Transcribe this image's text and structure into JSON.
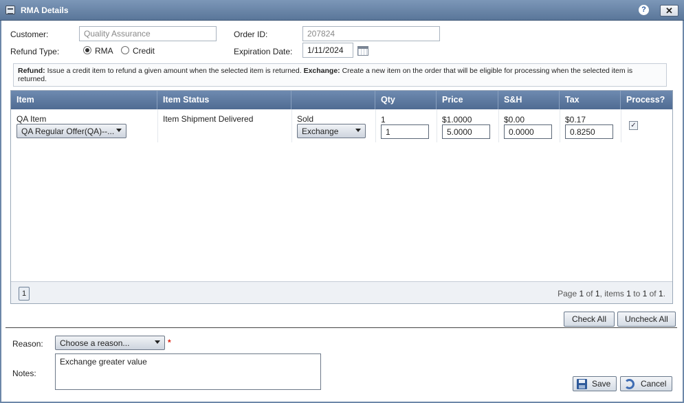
{
  "window": {
    "title": "RMA Details",
    "help_label": "?",
    "close_label": "✕"
  },
  "form": {
    "customer_label": "Customer:",
    "customer_value": "Quality Assurance",
    "order_id_label": "Order ID:",
    "order_id_value": "207824",
    "refund_type_label": "Refund Type:",
    "refund_options": [
      "RMA",
      "Credit"
    ],
    "refund_selected": "RMA",
    "expiration_label": "Expiration Date:",
    "expiration_value": "1/11/2024"
  },
  "note": {
    "refund_title": "Refund:",
    "refund_text": "Issue a credit item to refund a given amount when the selected item is returned.",
    "exchange_title": "Exchange:",
    "exchange_text": "Create a new item on the order that will be eligible for processing when the selected item is returned."
  },
  "grid": {
    "columns": [
      "Item",
      "Item Status",
      "",
      "Qty",
      "Price",
      "S&H",
      "Tax",
      "Process?"
    ],
    "row": {
      "item_name": "QA Item",
      "offer_value": "QA Regular Offer(QA)--...",
      "status": "Item Shipment Delivered",
      "sold_label": "Sold",
      "action_value": "Exchange",
      "qty_orig": "1",
      "qty_input": "1",
      "price_orig": "$1.0000",
      "price_input": "5.0000",
      "sh_orig": "$0.00",
      "sh_input": "0.0000",
      "tax_orig": "$0.17",
      "tax_input": "0.8250",
      "process_checked": true
    },
    "pager": {
      "page_button": "1",
      "page_text_1": "Page ",
      "page_num": "1",
      "page_text_2": " of ",
      "page_total": "1",
      "page_text_3": ", items ",
      "item_from": "1",
      "page_text_4": " to ",
      "item_to": "1",
      "page_text_5": " of ",
      "item_total": "1",
      "page_text_6": "."
    }
  },
  "actions": {
    "check_all": "Check All",
    "uncheck_all": "Uncheck All"
  },
  "bottom": {
    "reason_label": "Reason:",
    "reason_value": "Choose a reason...",
    "required_mark": "*",
    "notes_label": "Notes:",
    "notes_value": "Exchange greater value",
    "save_label": "Save",
    "cancel_label": "Cancel"
  },
  "colors": {
    "header": "#5a7699",
    "grid_header": "#5f7ba2",
    "required": "#dd2211"
  }
}
